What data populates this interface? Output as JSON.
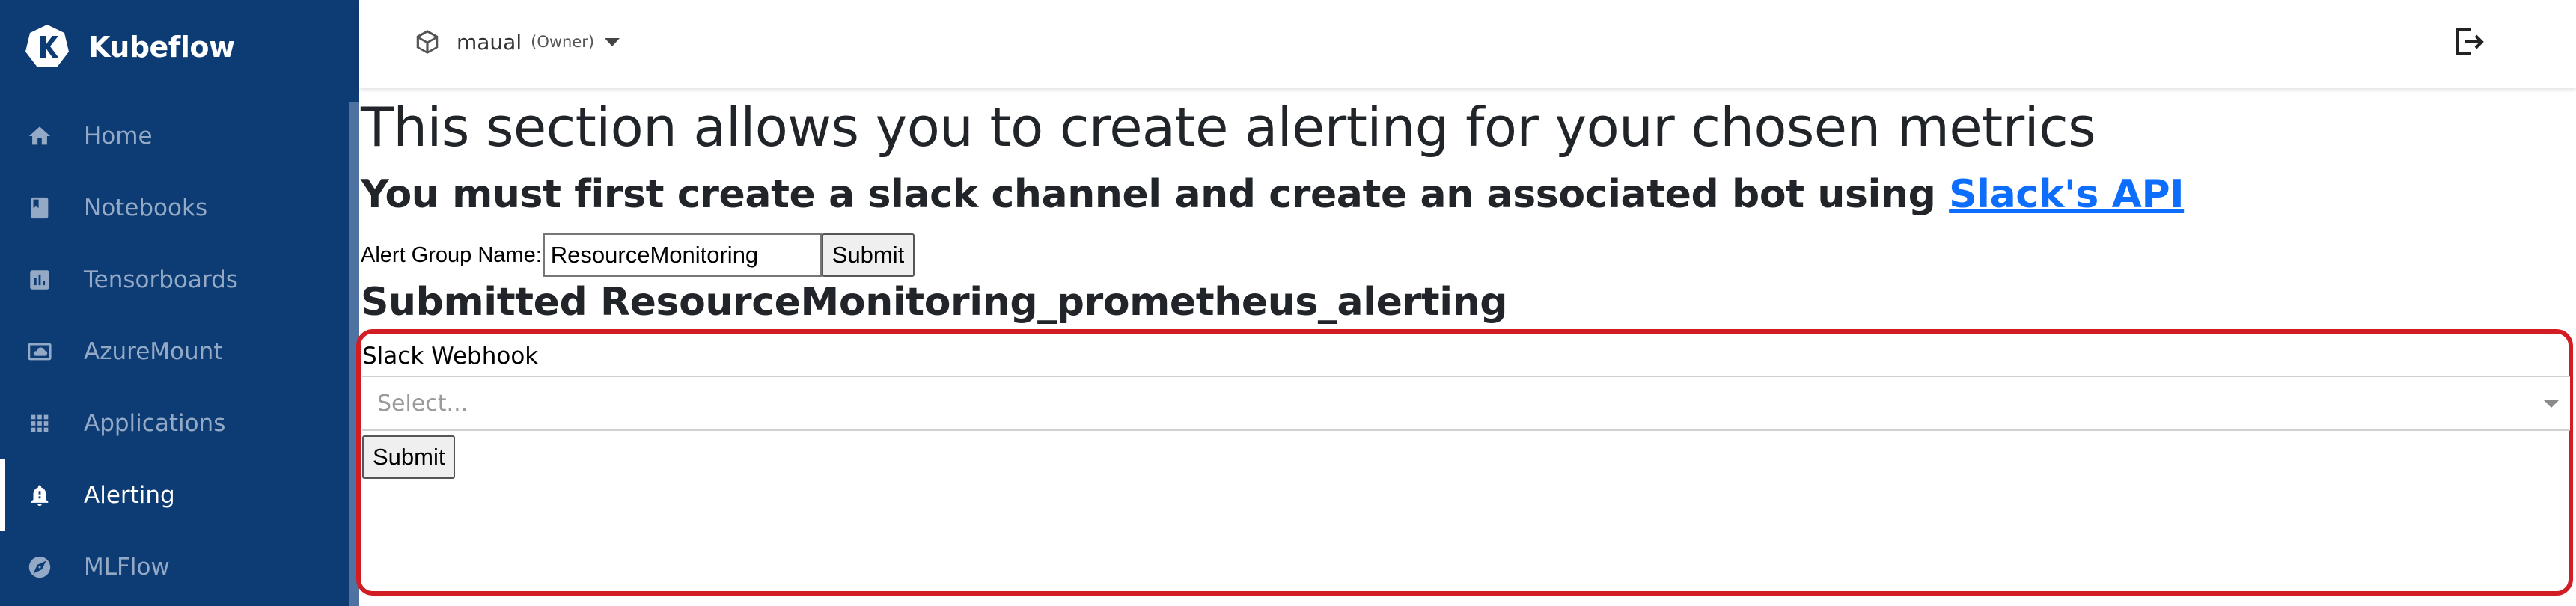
{
  "brand": {
    "name": "Kubeflow"
  },
  "sidebar": {
    "items": [
      {
        "label": "Home",
        "icon": "home-icon",
        "active": false
      },
      {
        "label": "Notebooks",
        "icon": "book-icon",
        "active": false
      },
      {
        "label": "Tensorboards",
        "icon": "chart-icon",
        "active": false
      },
      {
        "label": "AzureMount",
        "icon": "cloud-drive-icon",
        "active": false
      },
      {
        "label": "Applications",
        "icon": "apps-grid-icon",
        "active": false
      },
      {
        "label": "Alerting",
        "icon": "alert-bell-icon",
        "active": true
      },
      {
        "label": "MLFlow",
        "icon": "compass-icon",
        "active": false
      }
    ]
  },
  "topbar": {
    "namespace": "maual",
    "role": "(Owner)",
    "icons": {
      "namespace": "cube-icon",
      "logout": "logout-icon"
    }
  },
  "main": {
    "heading": "This section allows you to create alerting for your chosen metrics",
    "subheading_prefix": "You must first create a slack channel and create an associated bot using ",
    "subheading_link": "Slack's API",
    "form": {
      "label": "Alert Group Name:",
      "value": "ResourceMonitoring",
      "submit_label": "Submit"
    },
    "submitted_text": "Submitted ResourceMonitoring_prometheus_alerting",
    "webhook": {
      "label": "Slack Webhook",
      "placeholder": "Select...",
      "submit_label": "Submit"
    }
  },
  "colors": {
    "sidebar_bg": "#0d3b73",
    "link": "#0d6efd",
    "highlight_border": "#d21d25"
  }
}
